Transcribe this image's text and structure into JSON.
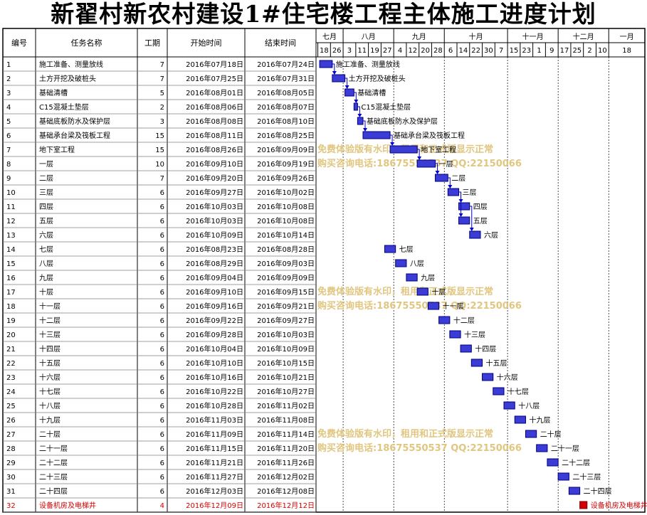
{
  "title": "新翟村新农村建设1#住宅楼工程主体施工进度计划",
  "columns": {
    "id": "编号",
    "name": "任务名称",
    "duration": "工期",
    "start": "开始时间",
    "end": "结束时间"
  },
  "months": [
    {
      "label": "七月",
      "start": "2016-07-16"
    },
    {
      "label": "八月",
      "start": "2016-07-31"
    },
    {
      "label": "九月",
      "start": "2016-08-28"
    },
    {
      "label": "十月",
      "start": "2016-09-25"
    },
    {
      "label": "十一月",
      "start": "2016-10-30"
    },
    {
      "label": "十二月",
      "start": "2016-11-27"
    },
    {
      "label": "一月",
      "start": "2016-12-25"
    }
  ],
  "timescale_start": "2016-07-16",
  "timescale_end": "2017-01-14",
  "weeks": [
    {
      "label": "18",
      "date": "2016-07-17"
    },
    {
      "label": "26",
      "date": "2016-07-24"
    },
    {
      "label": "3",
      "date": "2016-07-31"
    },
    {
      "label": "11",
      "date": "2016-08-07"
    },
    {
      "label": "19",
      "date": "2016-08-14"
    },
    {
      "label": "27",
      "date": "2016-08-21"
    },
    {
      "label": "4",
      "date": "2016-08-28"
    },
    {
      "label": "12",
      "date": "2016-09-04"
    },
    {
      "label": "20",
      "date": "2016-09-11"
    },
    {
      "label": "28",
      "date": "2016-09-18"
    },
    {
      "label": "6",
      "date": "2016-09-25"
    },
    {
      "label": "14",
      "date": "2016-10-02"
    },
    {
      "label": "22",
      "date": "2016-10-09"
    },
    {
      "label": "30",
      "date": "2016-10-16"
    },
    {
      "label": "7",
      "date": "2016-10-23"
    },
    {
      "label": "15",
      "date": "2016-10-30"
    },
    {
      "label": "23",
      "date": "2016-11-06"
    },
    {
      "label": "1",
      "date": "2016-11-13"
    },
    {
      "label": "9",
      "date": "2016-11-20"
    },
    {
      "label": "17",
      "date": "2016-11-27"
    },
    {
      "label": "25",
      "date": "2016-12-04"
    },
    {
      "label": "2",
      "date": "2016-12-11"
    },
    {
      "label": "10",
      "date": "2016-12-18"
    },
    {
      "label": "18",
      "date": "2016-12-25"
    }
  ],
  "watermarks": [
    {
      "line1": "免费体验版有水印，租用和正式版显示正常",
      "line2": "购买咨询电话:18675550537 QQ:22150066",
      "row": 7
    },
    {
      "line1": "免费体验版有水印，租用和正式版显示正常",
      "line2": "购买咨询电话:18675550537 QQ:22150066",
      "row": 17
    },
    {
      "line1": "免费体验版有水印，租用和正式版显示正常",
      "line2": "购买咨询电话:18675550537 QQ:22150066",
      "row": 27
    }
  ],
  "colors": {
    "bar": "#3b3bd6",
    "bar_border": "#00007a",
    "link": "#0000cc",
    "highlight": "#d40000",
    "grid": "#000000"
  },
  "chart_data": {
    "type": "gantt",
    "title": "新翟村新农村建设1#住宅楼工程主体施工进度计划",
    "tasks": [
      {
        "id": "1",
        "name": "施工准备、测量放线",
        "duration": 7,
        "start": "2016年07月18日",
        "end": "2016年07月24日",
        "s": "2016-07-18",
        "e": "2016-07-24"
      },
      {
        "id": "2",
        "name": "土方开挖及破桩头",
        "duration": 7,
        "start": "2016年07月25日",
        "end": "2016年07月31日",
        "s": "2016-07-25",
        "e": "2016-07-31"
      },
      {
        "id": "3",
        "name": "基础清槽",
        "duration": 5,
        "start": "2016年08月01日",
        "end": "2016年08月05日",
        "s": "2016-08-01",
        "e": "2016-08-05"
      },
      {
        "id": "4",
        "name": "C15混凝土垫层",
        "duration": 2,
        "start": "2016年08月06日",
        "end": "2016年08月07日",
        "s": "2016-08-06",
        "e": "2016-08-07"
      },
      {
        "id": "5",
        "name": "基础底板防水及保护层",
        "duration": 3,
        "start": "2016年08月08日",
        "end": "2016年08月10日",
        "s": "2016-08-08",
        "e": "2016-08-10"
      },
      {
        "id": "6",
        "name": "基础承台梁及筏板工程",
        "duration": 15,
        "start": "2016年08月11日",
        "end": "2016年08月25日",
        "s": "2016-08-11",
        "e": "2016-08-25"
      },
      {
        "id": "7",
        "name": "地下室工程",
        "duration": 15,
        "start": "2016年08月26日",
        "end": "2016年09月09日",
        "s": "2016-08-26",
        "e": "2016-09-09"
      },
      {
        "id": "8",
        "name": "一层",
        "duration": 10,
        "start": "2016年09月10日",
        "end": "2016年09月19日",
        "s": "2016-09-10",
        "e": "2016-09-19"
      },
      {
        "id": "9",
        "name": "二层",
        "duration": 7,
        "start": "2016年09月20日",
        "end": "2016年09月26日",
        "s": "2016-09-20",
        "e": "2016-09-26"
      },
      {
        "id": "10",
        "name": "三层",
        "duration": 6,
        "start": "2016年09月27日",
        "end": "2016年10月02日",
        "s": "2016-09-27",
        "e": "2016-10-02"
      },
      {
        "id": "11",
        "name": "四层",
        "duration": 6,
        "start": "2016年10月03日",
        "end": "2016年10月08日",
        "s": "2016-10-03",
        "e": "2016-10-08"
      },
      {
        "id": "12",
        "name": "五层",
        "duration": 6,
        "start": "2016年10月03日",
        "end": "2016年10月08日",
        "s": "2016-10-03",
        "e": "2016-10-08"
      },
      {
        "id": "13",
        "name": "六层",
        "duration": 6,
        "start": "2016年10月09日",
        "end": "2016年10月14日",
        "s": "2016-10-09",
        "e": "2016-10-14"
      },
      {
        "id": "14",
        "name": "七层",
        "duration": 6,
        "start": "2016年08月23日",
        "end": "2016年08月28日",
        "s": "2016-08-23",
        "e": "2016-08-28"
      },
      {
        "id": "15",
        "name": "八层",
        "duration": 6,
        "start": "2016年08月29日",
        "end": "2016年09月03日",
        "s": "2016-08-29",
        "e": "2016-09-03"
      },
      {
        "id": "16",
        "name": "九层",
        "duration": 6,
        "start": "2016年09月04日",
        "end": "2016年09月09日",
        "s": "2016-09-04",
        "e": "2016-09-09"
      },
      {
        "id": "17",
        "name": "十层",
        "duration": 6,
        "start": "2016年09月10日",
        "end": "2016年09月15日",
        "s": "2016-09-10",
        "e": "2016-09-15"
      },
      {
        "id": "18",
        "name": "十一层",
        "duration": 6,
        "start": "2016年09月16日",
        "end": "2016年09月21日",
        "s": "2016-09-16",
        "e": "2016-09-21"
      },
      {
        "id": "19",
        "name": "十二层",
        "duration": 6,
        "start": "2016年09月22日",
        "end": "2016年09月27日",
        "s": "2016-09-22",
        "e": "2016-09-27"
      },
      {
        "id": "20",
        "name": "十三层",
        "duration": 6,
        "start": "2016年09月28日",
        "end": "2016年10月03日",
        "s": "2016-09-28",
        "e": "2016-10-03"
      },
      {
        "id": "21",
        "name": "十四层",
        "duration": 6,
        "start": "2016年10月04日",
        "end": "2016年10月09日",
        "s": "2016-10-04",
        "e": "2016-10-09"
      },
      {
        "id": "22",
        "name": "十五层",
        "duration": 6,
        "start": "2016年10月10日",
        "end": "2016年10月15日",
        "s": "2016-10-10",
        "e": "2016-10-15"
      },
      {
        "id": "23",
        "name": "十六层",
        "duration": 6,
        "start": "2016年10月16日",
        "end": "2016年10月21日",
        "s": "2016-10-16",
        "e": "2016-10-21"
      },
      {
        "id": "24",
        "name": "十七层",
        "duration": 6,
        "start": "2016年10月22日",
        "end": "2016年10月27日",
        "s": "2016-10-22",
        "e": "2016-10-27"
      },
      {
        "id": "25",
        "name": "十八层",
        "duration": 6,
        "start": "2016年10月28日",
        "end": "2016年11月02日",
        "s": "2016-10-28",
        "e": "2016-11-02"
      },
      {
        "id": "26",
        "name": "十九层",
        "duration": 6,
        "start": "2016年11月03日",
        "end": "2016年11月08日",
        "s": "2016-11-03",
        "e": "2016-11-08"
      },
      {
        "id": "27",
        "name": "二十层",
        "duration": 6,
        "start": "2016年11月09日",
        "end": "2016年11月14日",
        "s": "2016-11-09",
        "e": "2016-11-14"
      },
      {
        "id": "28",
        "name": "二十一层",
        "duration": 6,
        "start": "2016年11月15日",
        "end": "2016年11月20日",
        "s": "2016-11-15",
        "e": "2016-11-20"
      },
      {
        "id": "29",
        "name": "二十二层",
        "duration": 6,
        "start": "2016年11月21日",
        "end": "2016年11月26日",
        "s": "2016-11-21",
        "e": "2016-11-26"
      },
      {
        "id": "30",
        "name": "二十三层",
        "duration": 6,
        "start": "2016年11月27日",
        "end": "2016年12月02日",
        "s": "2016-11-27",
        "e": "2016-12-02"
      },
      {
        "id": "31",
        "name": "二十四层",
        "duration": 6,
        "start": "2016年12月03日",
        "end": "2016年12月08日",
        "s": "2016-12-03",
        "e": "2016-12-08"
      },
      {
        "id": "32",
        "name": "设备机房及电梯井",
        "duration": 4,
        "start": "2016年12月09日",
        "end": "2016年12月12日",
        "s": "2016-12-09",
        "e": "2016-12-12",
        "highlight": true
      }
    ],
    "dependencies": [
      [
        1,
        2
      ],
      [
        2,
        3
      ],
      [
        3,
        4
      ],
      [
        4,
        5
      ],
      [
        5,
        6
      ],
      [
        6,
        7
      ],
      [
        7,
        8
      ],
      [
        8,
        9
      ],
      [
        9,
        10
      ],
      [
        10,
        11
      ],
      [
        10,
        12
      ],
      [
        11,
        13
      ]
    ]
  }
}
